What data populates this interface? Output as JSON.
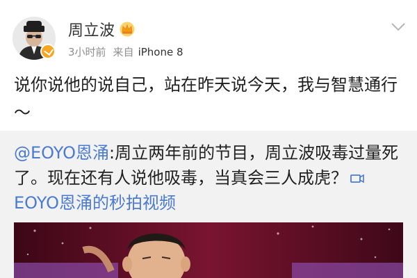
{
  "post": {
    "username": "周立波",
    "time": "3小时前",
    "source_label": "来自",
    "device": "iPhone 8",
    "text": "说你说他的说自己，站在昨天说今天，我与智慧通行～"
  },
  "repost": {
    "mention": "@EOYO恩涌",
    "body": ":周立两年前的节目，周立波吸毒过量死了。现在还有人说他吸毒，当真会三人成虎？",
    "video_link": "EOYO恩涌的秒拍视频"
  },
  "colors": {
    "link": "#4b7bd1",
    "badge": "#f5a623",
    "repost_bg": "#f2f2f2"
  },
  "icons": [
    "avatar",
    "verified-icon",
    "crown-icon",
    "chevron-down-icon",
    "video-icon"
  ]
}
